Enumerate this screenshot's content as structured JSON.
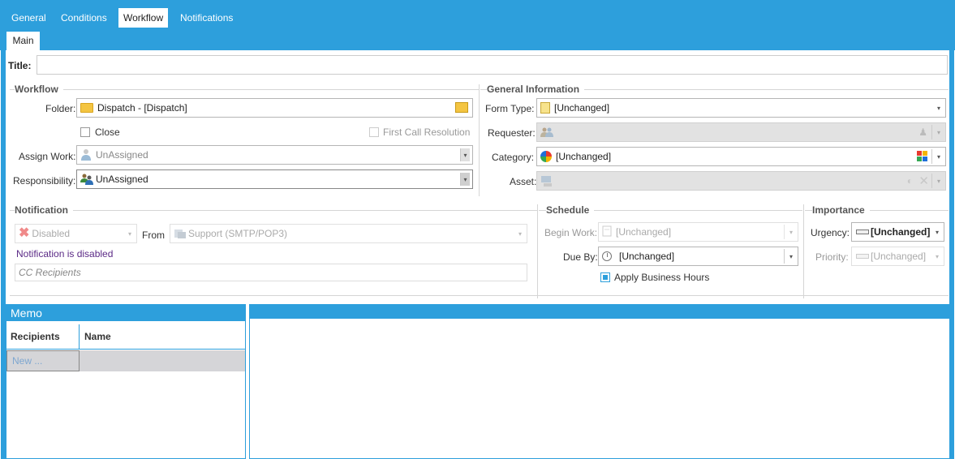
{
  "tabs": [
    "General",
    "Conditions",
    "Workflow",
    "Notifications"
  ],
  "active_tab": "Workflow",
  "subtab": "Main",
  "title_field": {
    "label": "Title:",
    "value": ""
  },
  "workflow": {
    "section": "Workflow",
    "folder_label": "Folder:",
    "folder_value": "Dispatch - [Dispatch]",
    "close_label": "Close",
    "fcr_label": "First Call Resolution",
    "assign_label": "Assign Work:",
    "assign_value": "UnAssigned",
    "responsibility_label": "Responsibility:",
    "responsibility_value": "UnAssigned"
  },
  "general_info": {
    "section": "General Information",
    "form_type_label": "Form Type:",
    "form_type_value": "[Unchanged]",
    "requester_label": "Requester:",
    "category_label": "Category:",
    "category_value": "[Unchanged]",
    "asset_label": "Asset:"
  },
  "notification": {
    "section": "Notification",
    "status_value": "Disabled",
    "from_label": "From",
    "from_value": "Support (SMTP/POP3)",
    "disabled_message": "Notification is disabled",
    "cc_placeholder": "CC Recipients"
  },
  "schedule": {
    "section": "Schedule",
    "begin_label": "Begin Work:",
    "begin_value": "[Unchanged]",
    "due_label": "Due By:",
    "due_value": "[Unchanged]",
    "business_hours_label": "Apply Business Hours"
  },
  "importance": {
    "section": "Importance",
    "urgency_label": "Urgency:",
    "urgency_value": "[Unchanged]",
    "priority_label": "Priority:",
    "priority_value": "[Unchanged]"
  },
  "memo": {
    "title": "Memo",
    "columns": [
      "Recipients",
      "Name"
    ],
    "new_row": "New ..."
  },
  "colors": {
    "accent": "#2d9fdc",
    "link": "#5b2a86"
  }
}
